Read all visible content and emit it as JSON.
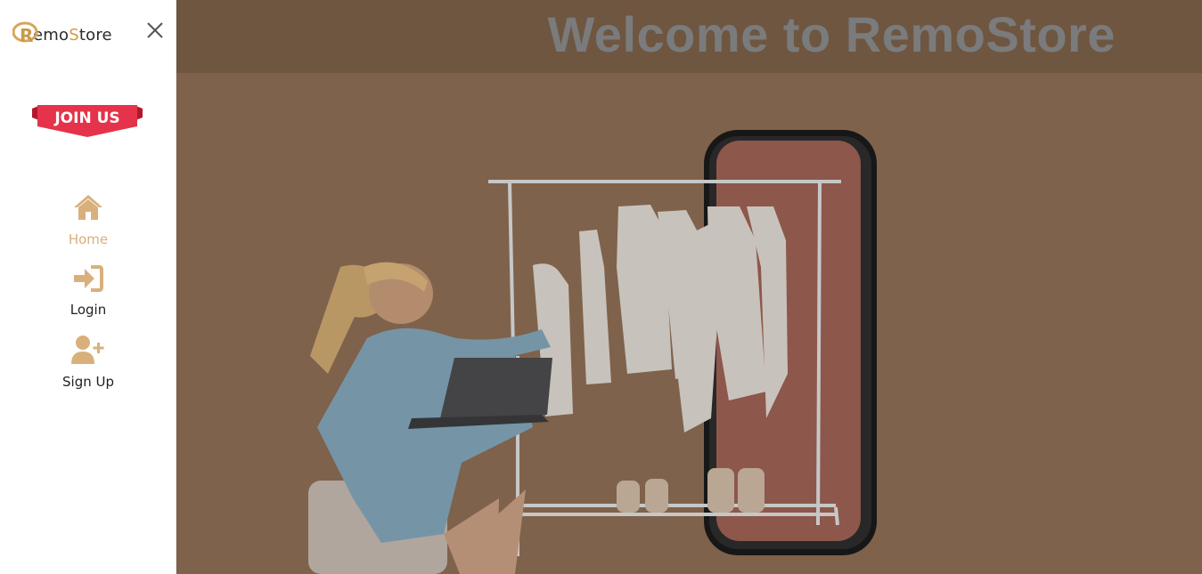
{
  "brand": {
    "logo_letter": "R",
    "name_pre": "emo",
    "name_s": "S",
    "name_post": "tore"
  },
  "sidebar": {
    "close_icon": "close-icon",
    "join_label": "JOIN US",
    "items": [
      {
        "label": "Home",
        "icon": "home-icon",
        "active": true
      },
      {
        "label": "Login",
        "icon": "login-icon",
        "active": false
      },
      {
        "label": "Sign Up",
        "icon": "user-plus-icon",
        "active": false
      }
    ]
  },
  "main": {
    "title": "Welcome to RemoStore"
  },
  "colors": {
    "accent": "#d9b07c",
    "join_red": "#e5334b",
    "overlay": "#6f5640"
  }
}
